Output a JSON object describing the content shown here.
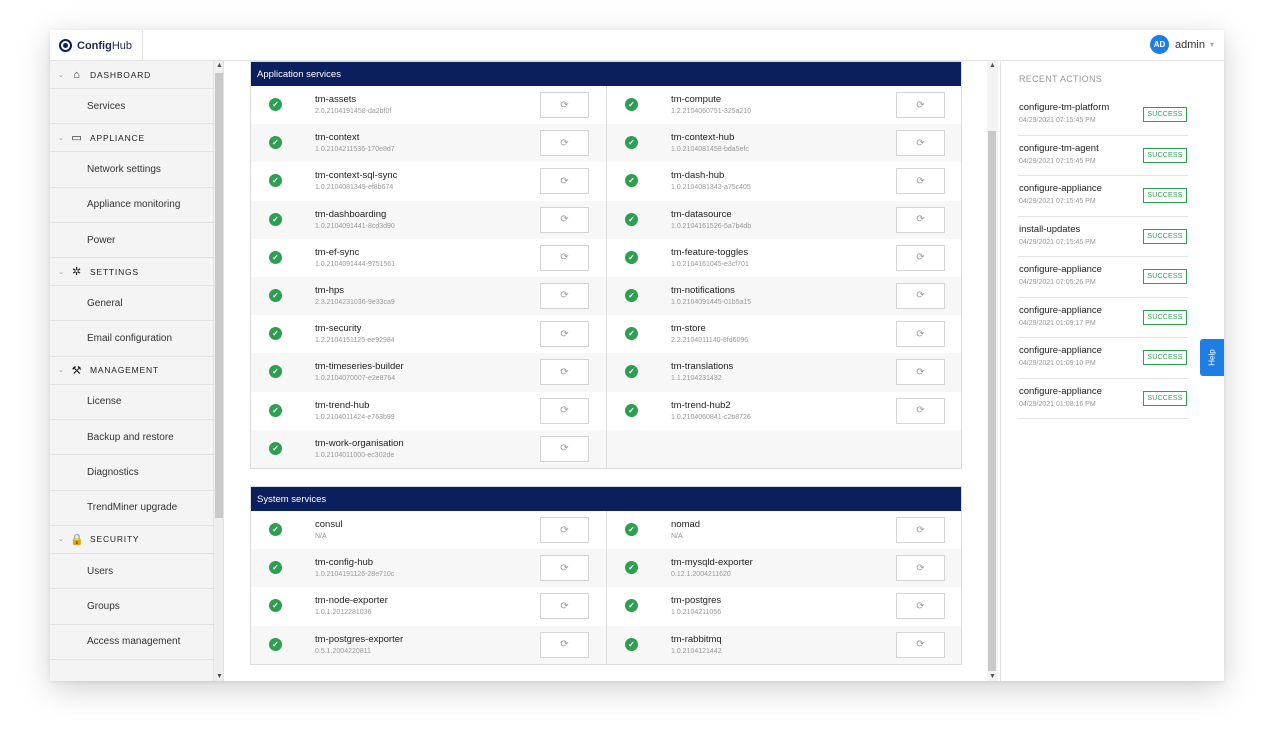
{
  "app": {
    "logo_bold": "Config",
    "logo_light": "Hub"
  },
  "user": {
    "initials": "AD",
    "name": "admin"
  },
  "sidebar": {
    "groups": [
      {
        "label": "DASHBOARD",
        "icon": "home-icon",
        "items": [
          "Services"
        ]
      },
      {
        "label": "APPLIANCE",
        "icon": "monitor-icon",
        "items": [
          "Network settings",
          "Appliance monitoring",
          "Power"
        ]
      },
      {
        "label": "SETTINGS",
        "icon": "gear-icon",
        "items": [
          "General",
          "Email configuration"
        ]
      },
      {
        "label": "MANAGEMENT",
        "icon": "wrench-icon",
        "items": [
          "License",
          "Backup and restore",
          "Diagnostics",
          "TrendMiner upgrade"
        ]
      },
      {
        "label": "SECURITY",
        "icon": "lock-icon",
        "items": [
          "Users",
          "Groups",
          "Access management"
        ]
      }
    ]
  },
  "application_services": {
    "title": "Application services",
    "left": [
      {
        "name": "tm-assets",
        "version": "2.0.2104191458-da2bf0f"
      },
      {
        "name": "tm-context",
        "version": "1.0.2104211536-170e8d7"
      },
      {
        "name": "tm-context-sql-sync",
        "version": "1.0.2104081349-ef8b674"
      },
      {
        "name": "tm-dashboarding",
        "version": "1.0.2104091441-8cd3d90"
      },
      {
        "name": "tm-ef-sync",
        "version": "1.0.2104091444-9751561"
      },
      {
        "name": "tm-hps",
        "version": "2.3.2104231036-9e33ca9"
      },
      {
        "name": "tm-security",
        "version": "1.2.2104151125-ee92984"
      },
      {
        "name": "tm-timeseries-builder",
        "version": "1.0.2104070007-e2e8764"
      },
      {
        "name": "tm-trend-hub",
        "version": "1.0.2104011424-e763b99"
      },
      {
        "name": "tm-work-organisation",
        "version": "1.0.2104011000-ec302de"
      }
    ],
    "right": [
      {
        "name": "tm-compute",
        "version": "1.2.2104060751-325a210"
      },
      {
        "name": "tm-context-hub",
        "version": "1.0.2104081458-bda5efc"
      },
      {
        "name": "tm-dash-hub",
        "version": "1.0.2104081343-a75c405"
      },
      {
        "name": "tm-datasource",
        "version": "1.0.2104161526-5a7b4db"
      },
      {
        "name": "tm-feature-toggles",
        "version": "1.0.2104161045-e3cf701"
      },
      {
        "name": "tm-notifications",
        "version": "1.0.2104091445-01b5a15"
      },
      {
        "name": "tm-store",
        "version": "2.2.2104011140-8fd6096"
      },
      {
        "name": "tm-translations",
        "version": "1.1.2104231432"
      },
      {
        "name": "tm-trend-hub2",
        "version": "1.0.2104060841-c2b8726"
      }
    ]
  },
  "system_services": {
    "title": "System services",
    "left": [
      {
        "name": "consul",
        "version": "N/A"
      },
      {
        "name": "tm-config-hub",
        "version": "1.0.2104191126-28e710c"
      },
      {
        "name": "tm-node-exporter",
        "version": "1.0.1.2012281036"
      },
      {
        "name": "tm-postgres-exporter",
        "version": "0.5.1.2004220811"
      }
    ],
    "right": [
      {
        "name": "nomad",
        "version": "N/A"
      },
      {
        "name": "tm-mysqld-exporter",
        "version": "0.12.1.2004211620"
      },
      {
        "name": "tm-postgres",
        "version": "1.0.2104211056"
      },
      {
        "name": "tm-rabbitmq",
        "version": "1.0.2104121442"
      }
    ]
  },
  "recent_actions": {
    "title": "RECENT ACTIONS",
    "items": [
      {
        "name": "configure-tm-platform",
        "time": "04/29/2021 07:15:45 PM",
        "status": "SUCCESS"
      },
      {
        "name": "configure-tm-agent",
        "time": "04/29/2021 07:15:45 PM",
        "status": "SUCCESS"
      },
      {
        "name": "configure-appliance",
        "time": "04/29/2021 07:15:45 PM",
        "status": "SUCCESS"
      },
      {
        "name": "install-updates",
        "time": "04/29/2021 07:15:45 PM",
        "status": "SUCCESS"
      },
      {
        "name": "configure-appliance",
        "time": "04/29/2021 07:05:26 PM",
        "status": "SUCCESS"
      },
      {
        "name": "configure-appliance",
        "time": "04/29/2021 01:09:17 PM",
        "status": "SUCCESS"
      },
      {
        "name": "configure-appliance",
        "time": "04/29/2021 01:09:10 PM",
        "status": "SUCCESS"
      },
      {
        "name": "configure-appliance",
        "time": "04/29/2021 01:08:16 PM",
        "status": "SUCCESS"
      }
    ]
  },
  "help": {
    "label": "Help"
  },
  "colors": {
    "navy": "#0b1f5e",
    "success": "#2e9e52",
    "accent": "#1e7ee6"
  }
}
